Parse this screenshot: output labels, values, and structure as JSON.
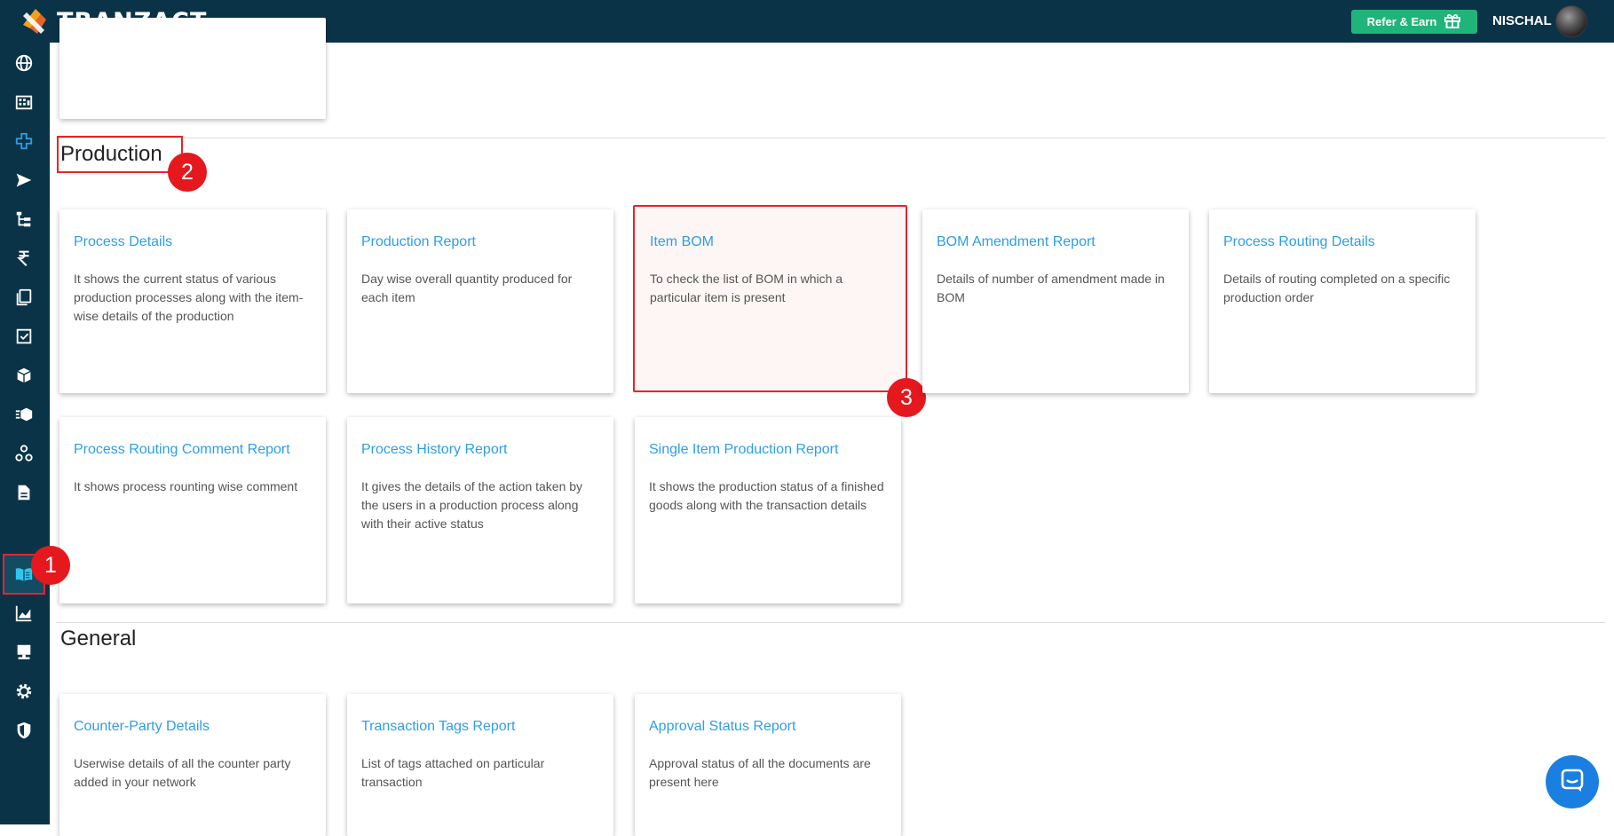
{
  "app": {
    "name": "TRANZACT"
  },
  "header": {
    "refer_label": "Refer & Earn",
    "user_name": "NISCHAL"
  },
  "sidebar": {
    "items": [
      {
        "icon": "globe-icon"
      },
      {
        "icon": "building-icon"
      },
      {
        "icon": "plus-cross-icon"
      },
      {
        "icon": "send-icon"
      },
      {
        "icon": "hierarchy-icon"
      },
      {
        "icon": "rupee-icon"
      },
      {
        "icon": "documents-icon"
      },
      {
        "icon": "checklist-icon"
      },
      {
        "icon": "box-icon"
      },
      {
        "icon": "box-list-icon"
      },
      {
        "icon": "network-icon"
      },
      {
        "icon": "file-icon"
      },
      {
        "icon": "book-open-icon",
        "active": true
      },
      {
        "icon": "chart-area-icon"
      },
      {
        "icon": "monitor-icon"
      },
      {
        "icon": "gear-icon"
      },
      {
        "icon": "shield-icon"
      }
    ]
  },
  "sections": {
    "production": {
      "title": "Production",
      "cards": [
        {
          "title": "Process Details",
          "desc": "It shows the current status of various production processes along with the item-wise details of the production"
        },
        {
          "title": "Production Report",
          "desc": "Day wise overall quantity produced for each item"
        },
        {
          "title": "Item BOM",
          "desc": "To check the list of BOM in which a particular item is present"
        },
        {
          "title": "BOM Amendment Report",
          "desc": "Details of number of amendment made in BOM"
        },
        {
          "title": "Process Routing Details",
          "desc": "Details of routing completed on a specific production order"
        },
        {
          "title": "Process Routing Comment Report",
          "desc": "It shows process rounting wise comment"
        },
        {
          "title": "Process History Report",
          "desc": "It gives the details of the action taken by the users in a production process along with their active status"
        },
        {
          "title": "Single Item Production Report",
          "desc": "It shows the production status of a finished goods along with the transaction details"
        }
      ]
    },
    "general": {
      "title": "General",
      "cards": [
        {
          "title": "Counter-Party Details",
          "desc": "Userwise details of all the counter party added in your network"
        },
        {
          "title": "Transaction Tags Report",
          "desc": "List of tags attached on particular transaction"
        },
        {
          "title": "Approval Status Report",
          "desc": "Approval status of all the documents are present here"
        }
      ]
    }
  },
  "annotations": {
    "marker_1": "1",
    "marker_2": "2",
    "marker_3": "3"
  },
  "colors": {
    "topbar": "#0b3347",
    "accent_link": "#2e9ee6",
    "refer_green": "#1fb57a",
    "annotation_red": "#e5181e"
  }
}
